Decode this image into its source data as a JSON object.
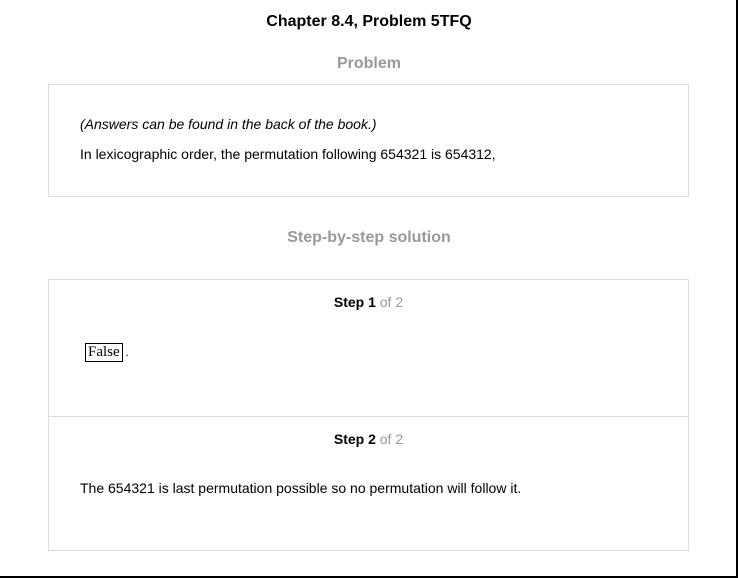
{
  "header": {
    "title": "Chapter 8.4, Problem 5TFQ"
  },
  "problem": {
    "heading": "Problem",
    "note": "(Answers can be found in the back of the book.)",
    "statement": "In lexicographic order, the permutation following 654321 is 654312,"
  },
  "solution": {
    "heading": "Step-by-step solution",
    "steps": [
      {
        "label": "Step 1",
        "of": " of 2",
        "answer": "False",
        "punctuation": "."
      },
      {
        "label": "Step 2",
        "of": " of 2",
        "text": "The 654321 is last permutation possible so no permutation will follow it."
      }
    ]
  }
}
